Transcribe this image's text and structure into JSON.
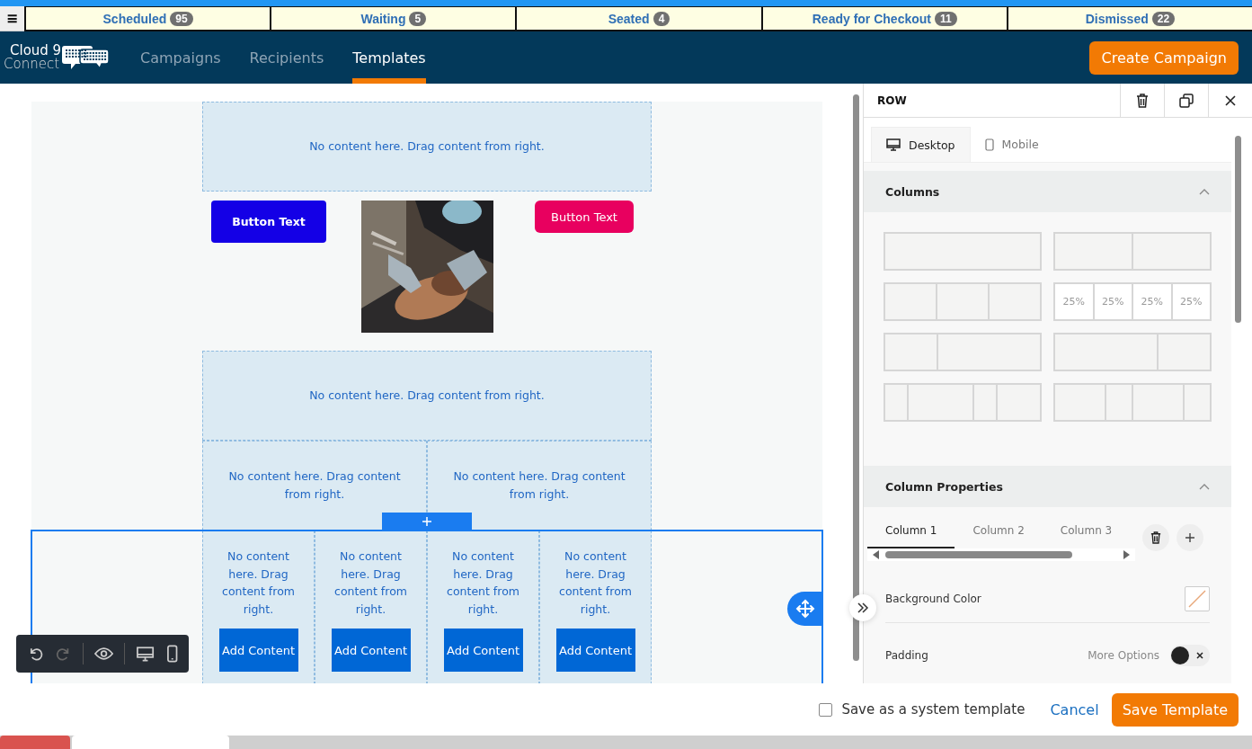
{
  "menu_button": {
    "label": "≡"
  },
  "status_tabs": [
    {
      "label": "Scheduled",
      "count": "95"
    },
    {
      "label": "Waiting",
      "count": "5"
    },
    {
      "label": "Seated",
      "count": "4"
    },
    {
      "label": "Ready for Checkout",
      "count": "11"
    },
    {
      "label": "Dismissed",
      "count": "22"
    }
  ],
  "logo": {
    "line1": "Cloud 9",
    "line2": "Connect"
  },
  "nav": [
    {
      "label": "Campaigns",
      "selected": false
    },
    {
      "label": "Recipients",
      "selected": false
    },
    {
      "label": "Templates",
      "selected": true
    }
  ],
  "create_button": "Create Campaign",
  "canvas_rows": [
    {
      "selected": false,
      "columns": [
        {
          "kind": "empty",
          "text": "No content here. Drag content from right."
        }
      ]
    },
    {
      "selected": false,
      "kind": "media",
      "columns": [
        {
          "kind": "button",
          "label": "Button Text",
          "color": "#1400e6"
        },
        {
          "kind": "picture"
        },
        {
          "kind": "button",
          "label": "Button Text",
          "color": "#e8005f"
        }
      ]
    },
    {
      "selected": false,
      "columns": [
        {
          "kind": "empty",
          "text": "No content here. Drag content from right."
        }
      ]
    },
    {
      "selected": false,
      "columns": [
        {
          "kind": "empty",
          "text": "No content here. Drag content from right."
        },
        {
          "kind": "empty",
          "text": "No content here. Drag content from right."
        }
      ]
    },
    {
      "selected": true,
      "columns": [
        {
          "kind": "empty",
          "text": "No content here. Drag content from right.",
          "button": "Add Content"
        },
        {
          "kind": "empty",
          "text": "No content here. Drag content from right.",
          "button": "Add Content"
        },
        {
          "kind": "empty",
          "text": "No content here. Drag content from right.",
          "button": "Add Content"
        },
        {
          "kind": "empty",
          "text": "No content here. Drag content from right.",
          "button": "Add Content"
        }
      ]
    }
  ],
  "panel": {
    "title": "ROW",
    "device_tabs": [
      {
        "label": "Desktop",
        "kind": "desktop",
        "selected": true
      },
      {
        "label": "Mobile",
        "kind": "mobile",
        "selected": false
      }
    ],
    "columns_section": {
      "title": "Columns",
      "expanded": true,
      "presets": [
        {
          "selected": false
        },
        {
          "selected": false
        },
        {
          "selected": false
        },
        {
          "selected": true,
          "labels": [
            "25%",
            "25%",
            "25%",
            "25%"
          ]
        },
        {
          "selected": false
        },
        {
          "selected": false
        },
        {
          "selected": false
        },
        {
          "selected": false
        }
      ]
    },
    "properties_section": {
      "title": "Column Properties",
      "expanded": true,
      "column_tabs": [
        {
          "label": "Column 1",
          "selected": true
        },
        {
          "label": "Column 2",
          "selected": false
        },
        {
          "label": "Column 3",
          "selected": false
        }
      ],
      "background_label": "Background Color",
      "padding_label": "Padding",
      "more_options": {
        "label": "More Options",
        "on": false
      }
    }
  },
  "footer": {
    "system_template": {
      "label": "Save as a system template",
      "checked": false
    },
    "cancel": "Cancel",
    "save": "Save Template"
  }
}
